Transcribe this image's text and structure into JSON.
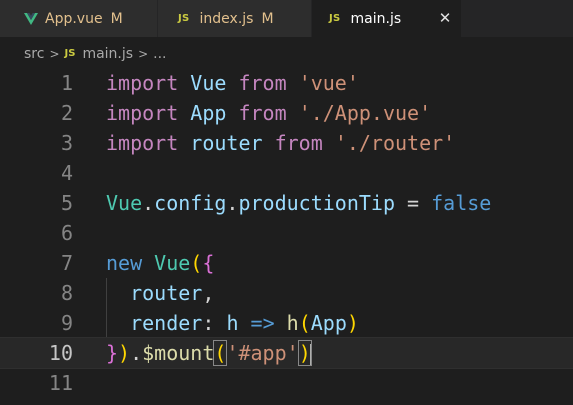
{
  "tabs": [
    {
      "label": "App.vue",
      "modified": "M",
      "icon": "vue-icon"
    },
    {
      "label": "index.js",
      "modified": "M",
      "icon": "js-icon",
      "icon_text": "JS"
    },
    {
      "label": "main.js",
      "close": "✕",
      "icon": "js-icon",
      "icon_text": "JS",
      "active": true
    }
  ],
  "breadcrumb": {
    "folder": "src",
    "separator": ">",
    "file_icon_text": "JS",
    "file": "main.js",
    "more": "..."
  },
  "editor": {
    "current_line": 10,
    "lines": [
      {
        "number": "1",
        "tokens": [
          {
            "t": "import",
            "c": "kw"
          },
          {
            "t": " ",
            "c": "pl"
          },
          {
            "t": "Vue",
            "c": "id"
          },
          {
            "t": " ",
            "c": "pl"
          },
          {
            "t": "from",
            "c": "kw"
          },
          {
            "t": " ",
            "c": "pl"
          },
          {
            "t": "'vue'",
            "c": "str"
          }
        ]
      },
      {
        "number": "2",
        "tokens": [
          {
            "t": "import",
            "c": "kw"
          },
          {
            "t": " ",
            "c": "pl"
          },
          {
            "t": "App",
            "c": "id"
          },
          {
            "t": " ",
            "c": "pl"
          },
          {
            "t": "from",
            "c": "kw"
          },
          {
            "t": " ",
            "c": "pl"
          },
          {
            "t": "'./App.vue'",
            "c": "str"
          }
        ]
      },
      {
        "number": "3",
        "tokens": [
          {
            "t": "import",
            "c": "kw"
          },
          {
            "t": " ",
            "c": "pl"
          },
          {
            "t": "router",
            "c": "id"
          },
          {
            "t": " ",
            "c": "pl"
          },
          {
            "t": "from",
            "c": "kw"
          },
          {
            "t": " ",
            "c": "pl"
          },
          {
            "t": "'./router'",
            "c": "str"
          }
        ]
      },
      {
        "number": "4",
        "tokens": []
      },
      {
        "number": "5",
        "tokens": [
          {
            "t": "Vue",
            "c": "cls"
          },
          {
            "t": ".",
            "c": "pl"
          },
          {
            "t": "config",
            "c": "id"
          },
          {
            "t": ".",
            "c": "pl"
          },
          {
            "t": "productionTip",
            "c": "id"
          },
          {
            "t": " = ",
            "c": "pl"
          },
          {
            "t": "false",
            "c": "bkw"
          }
        ]
      },
      {
        "number": "6",
        "tokens": []
      },
      {
        "number": "7",
        "tokens": [
          {
            "t": "new",
            "c": "bkw"
          },
          {
            "t": " ",
            "c": "pl"
          },
          {
            "t": "Vue",
            "c": "cls"
          },
          {
            "t": "(",
            "c": "br"
          },
          {
            "t": "{",
            "c": "br2"
          }
        ]
      },
      {
        "number": "8",
        "guide": true,
        "tokens": [
          {
            "t": "  ",
            "c": "pl"
          },
          {
            "t": "router",
            "c": "id"
          },
          {
            "t": ",",
            "c": "pl"
          }
        ]
      },
      {
        "number": "9",
        "guide": true,
        "tokens": [
          {
            "t": "  ",
            "c": "pl"
          },
          {
            "t": "render",
            "c": "id"
          },
          {
            "t": ": ",
            "c": "pl"
          },
          {
            "t": "h",
            "c": "id"
          },
          {
            "t": " ",
            "c": "pl"
          },
          {
            "t": "=>",
            "c": "bkw"
          },
          {
            "t": " ",
            "c": "pl"
          },
          {
            "t": "h",
            "c": "fn"
          },
          {
            "t": "(",
            "c": "br"
          },
          {
            "t": "App",
            "c": "id"
          },
          {
            "t": ")",
            "c": "br"
          }
        ]
      },
      {
        "number": "10",
        "tokens": [
          {
            "t": "}",
            "c": "br2"
          },
          {
            "t": ")",
            "c": "br"
          },
          {
            "t": ".",
            "c": "pl"
          },
          {
            "t": "$mount",
            "c": "fn"
          },
          {
            "t": "(",
            "c": "br",
            "match": true
          },
          {
            "t": "'#app'",
            "c": "str"
          },
          {
            "t": ")",
            "c": "br",
            "match": true,
            "caret": true
          }
        ]
      },
      {
        "number": "11",
        "tokens": []
      }
    ]
  },
  "colors": {
    "background": "#1e1e1e",
    "tabbar": "#252526",
    "inactive_tab": "#2d2d2d",
    "modified": "#e2c08d",
    "keyword": "#c586c0",
    "blue_keyword": "#569cd6",
    "variable": "#9cdcfe",
    "class": "#4ec9b0",
    "string": "#ce9178",
    "function": "#dcdcaa",
    "bracket_gold": "#ffd700",
    "bracket_orchid": "#da70d6"
  }
}
